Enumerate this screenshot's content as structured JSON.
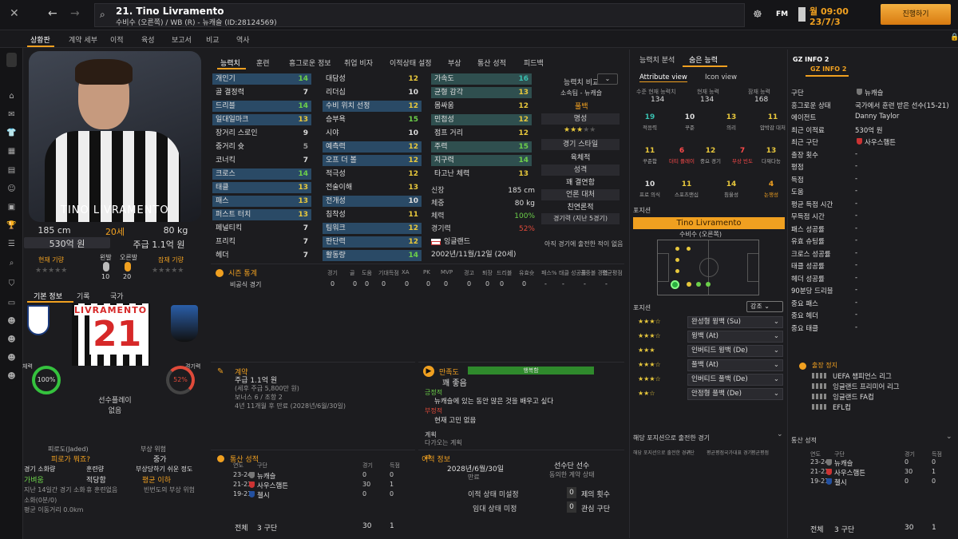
{
  "header": {
    "player_title": "21. Tino Livramento",
    "player_sub": "수비수 (오른쪽) / WB (R) - 뉴캐슬 (ID:28124569)",
    "date": "월 09:00",
    "date2": "23/7/3",
    "continue_label": "진행하기",
    "fm_label": "FM"
  },
  "menu": [
    "상황판",
    "계약 세부",
    "이적",
    "육성",
    "보고서",
    "비교",
    "역사"
  ],
  "profile": {
    "height": "185 cm",
    "age": "20세",
    "weight": "80 kg",
    "value": "530억 원",
    "wage": "주급 1.1억 원",
    "current_ability": "현재 기량",
    "potential_ability": "잠재 기량",
    "left_foot": "왼발",
    "right_foot": "오른발",
    "left_foot_val": "10",
    "right_foot_val": "20",
    "name_on_shirt": "TINO LIVRAMENTO",
    "shirt_name": "LIVRAMENTO",
    "shirt_number": "21",
    "tabs": [
      "기본 정보",
      "기록",
      "국가"
    ],
    "fitness_label": "체력",
    "fitness_pct": "100%",
    "sharpness_label": "경기력",
    "sharpness_pct": "52%",
    "preferred_play_label": "선수플레이",
    "preferred_play": "없음",
    "jaded_label": "피로도(Jaded)",
    "jaded_value": "피로가 뭐죠?",
    "injury_risk_label": "부상 위험",
    "injury_risk_value": "중가",
    "match_load_label": "경기 소화량",
    "match_load_value": "가벼움",
    "training_label": "훈련량",
    "training_value": "적당함",
    "injury_prone_label": "부상당하기 쉬운 정도",
    "injury_prone_value": "평균 이하",
    "last14_label": "지난 14일간 경기 소화",
    "no_training": "휴 훈련없음",
    "repeat_injury": "빈번도의 부상 위험",
    "minutes_label": "소화(0분/0)",
    "avg_dist": "평균 이동거리 0.0km"
  },
  "attr_tabs": [
    "능력치",
    "훈련",
    "흥그로운 정보",
    "취업 비자",
    "이적상태 설정",
    "부상",
    "통산 성적",
    "피드백"
  ],
  "attributes": {
    "col1": [
      {
        "n": "개인기",
        "v": "14",
        "c": "g",
        "bg": "blue"
      },
      {
        "n": "골 결정력",
        "v": "7",
        "c": "w",
        "bg": ""
      },
      {
        "n": "드리블",
        "v": "14",
        "c": "g",
        "bg": "blue"
      },
      {
        "n": "일대일마크",
        "v": "13",
        "c": "y",
        "bg": "blue"
      },
      {
        "n": "장거리 스로인",
        "v": "9",
        "c": "w",
        "bg": ""
      },
      {
        "n": "중거리 슛",
        "v": "5",
        "c": "gr",
        "bg": ""
      },
      {
        "n": "코너킥",
        "v": "7",
        "c": "w",
        "bg": ""
      },
      {
        "n": "크로스",
        "v": "14",
        "c": "g",
        "bg": "blue"
      },
      {
        "n": "태클",
        "v": "13",
        "c": "y",
        "bg": "blue"
      },
      {
        "n": "패스",
        "v": "13",
        "c": "y",
        "bg": "blue"
      },
      {
        "n": "퍼스트 터치",
        "v": "13",
        "c": "y",
        "bg": "blue"
      },
      {
        "n": "페널티킥",
        "v": "7",
        "c": "w",
        "bg": ""
      },
      {
        "n": "프리킥",
        "v": "7",
        "c": "w",
        "bg": ""
      },
      {
        "n": "헤더",
        "v": "7",
        "c": "w",
        "bg": ""
      }
    ],
    "col2": [
      {
        "n": "대담성",
        "v": "12",
        "c": "y",
        "bg": ""
      },
      {
        "n": "리더십",
        "v": "10",
        "c": "w",
        "bg": ""
      },
      {
        "n": "수비 위치 선정",
        "v": "12",
        "c": "y",
        "bg": "blue"
      },
      {
        "n": "승부욕",
        "v": "15",
        "c": "g",
        "bg": ""
      },
      {
        "n": "시야",
        "v": "10",
        "c": "w",
        "bg": ""
      },
      {
        "n": "예측력",
        "v": "12",
        "c": "y",
        "bg": "blue"
      },
      {
        "n": "오프 더 볼",
        "v": "12",
        "c": "y",
        "bg": "blue"
      },
      {
        "n": "적극성",
        "v": "12",
        "c": "y",
        "bg": ""
      },
      {
        "n": "전술이해",
        "v": "13",
        "c": "y",
        "bg": ""
      },
      {
        "n": "전개성",
        "v": "10",
        "c": "w",
        "bg": "blue"
      },
      {
        "n": "침착성",
        "v": "11",
        "c": "y",
        "bg": ""
      },
      {
        "n": "팀워크",
        "v": "12",
        "c": "y",
        "bg": "blue"
      },
      {
        "n": "판단력",
        "v": "12",
        "c": "y",
        "bg": "blue"
      },
      {
        "n": "활동량",
        "v": "14",
        "c": "g",
        "bg": "blue"
      }
    ],
    "col3": [
      {
        "n": "가속도",
        "v": "16",
        "c": "t",
        "bg": "teal"
      },
      {
        "n": "균형 감각",
        "v": "13",
        "c": "y",
        "bg": "teal"
      },
      {
        "n": "몸싸움",
        "v": "12",
        "c": "y",
        "bg": ""
      },
      {
        "n": "민첩성",
        "v": "12",
        "c": "y",
        "bg": "teal"
      },
      {
        "n": "점프 거리",
        "v": "12",
        "c": "y",
        "bg": ""
      },
      {
        "n": "주력",
        "v": "15",
        "c": "g",
        "bg": "teal"
      },
      {
        "n": "지구력",
        "v": "14",
        "c": "g",
        "bg": "teal"
      },
      {
        "n": "타고난 체력",
        "v": "13",
        "c": "y",
        "bg": ""
      }
    ]
  },
  "info_box": {
    "height_label": "신장",
    "height": "185 cm",
    "weight_label": "체중",
    "weight": "80 kg",
    "fitness_label": "체력",
    "fitness": "100%",
    "sharp_label": "경기력",
    "sharp": "52%",
    "nation": "잉글랜드",
    "dob": "2002년/11월/12일 (20세)"
  },
  "compare": {
    "title": "능력치 비교",
    "affiliation": "소속팀 - 뉴캐슬",
    "position": "풀백",
    "reputation_label": "명성",
    "style_label": "경기 스타일",
    "style": "육체적",
    "personality_label": "성격",
    "personality": "꽤 결연함",
    "media_label": "언론 대처",
    "media": "친연론적",
    "form_label": "경기력 (지난 5경기)",
    "no_games": "아직 경기에 출전한 적이 없음"
  },
  "season_stats": {
    "title": "시즌 통계",
    "cols": [
      "경기",
      "골",
      "도움",
      "기대득점",
      "XA",
      "PK",
      "MVP",
      "경고",
      "퇴장",
      "드리블",
      "유효슛",
      "패스%",
      "태클 성공률",
      "공중볼 경합",
      "평균평점"
    ],
    "row_label": "비공식 경기",
    "values": [
      "0",
      "0",
      "0",
      "0",
      "0",
      "0",
      "0",
      "0",
      "0",
      "0",
      "0",
      "-",
      "-",
      "-",
      "-"
    ]
  },
  "contract": {
    "title": "계약",
    "wage": "주급 1.1억 원",
    "tax": "(세후 주급 5,800만 원)",
    "bonus": "보너스 6 / 조항 2",
    "expiry": "4년 11개월 후 만료 (2028년/6월/30일)"
  },
  "happiness": {
    "title": "만족도",
    "level": "행복함",
    "summary": "꽤 좋음",
    "pos_label": "긍정적",
    "pos": "뉴캐슬에 있는 동안 많은 것을 배우고 싶다",
    "neg_label": "부정적",
    "neg": "현재 고민 없음",
    "plan_label": "계획",
    "plan": "다가오는 계획"
  },
  "career": {
    "title": "통산 성적",
    "cols": [
      "연도",
      "구단",
      "경기",
      "득점"
    ],
    "rows": [
      {
        "y": "23-24",
        "club": "뉴캐슬",
        "apps": "0",
        "g": "0"
      },
      {
        "y": "21-23",
        "club": "사우스햄튼",
        "apps": "30",
        "g": "1"
      },
      {
        "y": "19-21",
        "club": "첼시",
        "apps": "0",
        "g": "0"
      }
    ],
    "total_label": "전체",
    "total_clubs": "3 구단",
    "total_apps": "30",
    "total_goals": "1"
  },
  "transfer": {
    "title": "이적 정보",
    "contract_end": "2028년/6월/30일",
    "contract_end_label": "만료",
    "squad_status": "선수단 선수",
    "squad_status_label": "동의한 계약 상태",
    "transfer_status": "이적 상태 미설정",
    "loan_status": "임대 상태 미정",
    "offers": "제의 횟수",
    "offers_val": "0",
    "interest": "관심 구단",
    "interest_val": "0"
  },
  "analysis": {
    "tabs": [
      "능력치 분석",
      "숨은 능력"
    ],
    "views": [
      "Attribute view",
      "Icon view"
    ],
    "ability_labels": [
      "수준 현재 능력치",
      "현재 능력",
      "잠재 능력"
    ],
    "ability_vals": [
      "134",
      "134",
      "168"
    ],
    "stats": [
      {
        "v": "19",
        "l": "적응력",
        "c": "t"
      },
      {
        "v": "10",
        "l": "꾸준",
        "c": "w"
      },
      {
        "v": "13",
        "l": "의리",
        "c": "y"
      },
      {
        "v": "11",
        "l": "압박감 대처",
        "c": "y"
      },
      {
        "v": "11",
        "l": "꾸준함",
        "c": "y"
      },
      {
        "v": "6",
        "l": "더티 플레이",
        "c": "r"
      },
      {
        "v": "12",
        "l": "중요 경기",
        "c": "y"
      },
      {
        "v": "7",
        "l": "부상 빈도",
        "c": "r"
      },
      {
        "v": "13",
        "l": "다재다능",
        "c": "y"
      },
      {
        "v": "10",
        "l": "프로 의식",
        "c": "w"
      },
      {
        "v": "11",
        "l": "스포츠맨십",
        "c": "y"
      },
      {
        "v": "14",
        "l": "침울성",
        "c": "y"
      },
      {
        "v": "4",
        "l": "논쟁성",
        "c": "o"
      }
    ],
    "position_label": "포지션",
    "name_bar": "Tino Livramento",
    "role_text": "수비수 (오른쪽)",
    "roles_title": "포지션",
    "emphasis": "강조",
    "roles": [
      {
        "stars": "★★★☆",
        "role": "완성형 윙백 (Su)"
      },
      {
        "stars": "★★★☆",
        "role": "윙백 (At)"
      },
      {
        "stars": "★★★",
        "role": "인버티드 윙백 (De)"
      },
      {
        "stars": "★★★☆",
        "role": "풀백 (At)"
      },
      {
        "stars": "★★★☆",
        "role": "인버티드 풀백 (De)"
      },
      {
        "stars": "★★☆",
        "role": "안정형 풀백 (De)"
      }
    ],
    "played_title": "해당 포지션으로 출전한 경기",
    "played_cols": [
      "해당 포지션으로 출전한 경기",
      "구단",
      "평균평점",
      "국가대표 경기",
      "평균평점"
    ]
  },
  "gz": {
    "title": "GZ INFO 2",
    "subtitle": "GZ INFO 2",
    "rows": [
      {
        "k": "구단",
        "v": "뉴캐슬"
      },
      {
        "k": "흥그로운 상태",
        "v": "국가에서 훈련 받은 선수(15-21)"
      },
      {
        "k": "에이전트",
        "v": "Danny Taylor"
      },
      {
        "k": "최근 이적료",
        "v": "530억 원"
      },
      {
        "k": "최근 구단",
        "v": "사우스햄튼"
      },
      {
        "k": "출장 횟수",
        "v": "-"
      },
      {
        "k": "평점",
        "v": "-"
      },
      {
        "k": "득점",
        "v": "-"
      },
      {
        "k": "도움",
        "v": "-"
      },
      {
        "k": "평균 득점 시간",
        "v": "-"
      },
      {
        "k": "무득점 시간",
        "v": "-"
      },
      {
        "k": "패스 성공률",
        "v": "-"
      },
      {
        "k": "유효 슈팅률",
        "v": "-"
      },
      {
        "k": "크로스 성공률",
        "v": "-"
      },
      {
        "k": "태클 성공률",
        "v": "-"
      },
      {
        "k": "헤더 성공률",
        "v": "-"
      },
      {
        "k": "90분당 드리블",
        "v": "-"
      },
      {
        "k": "중요 패스",
        "v": "-"
      },
      {
        "k": "중요 헤더",
        "v": "-"
      },
      {
        "k": "중요 태클",
        "v": "-"
      }
    ],
    "qual_title": "출장 정지",
    "comps": [
      "UEFA 챔피언스 리그",
      "잉글랜드 프리미어 리그",
      "잉글랜드 FA컵",
      "EFL컵"
    ],
    "career_title": "통산 성적"
  },
  "colors": {
    "accent": "#f0a020",
    "good": "#6cd04a",
    "mid": "#e8c83c",
    "blue_row": "#2a4a66",
    "teal_row": "#2f4f4f"
  }
}
